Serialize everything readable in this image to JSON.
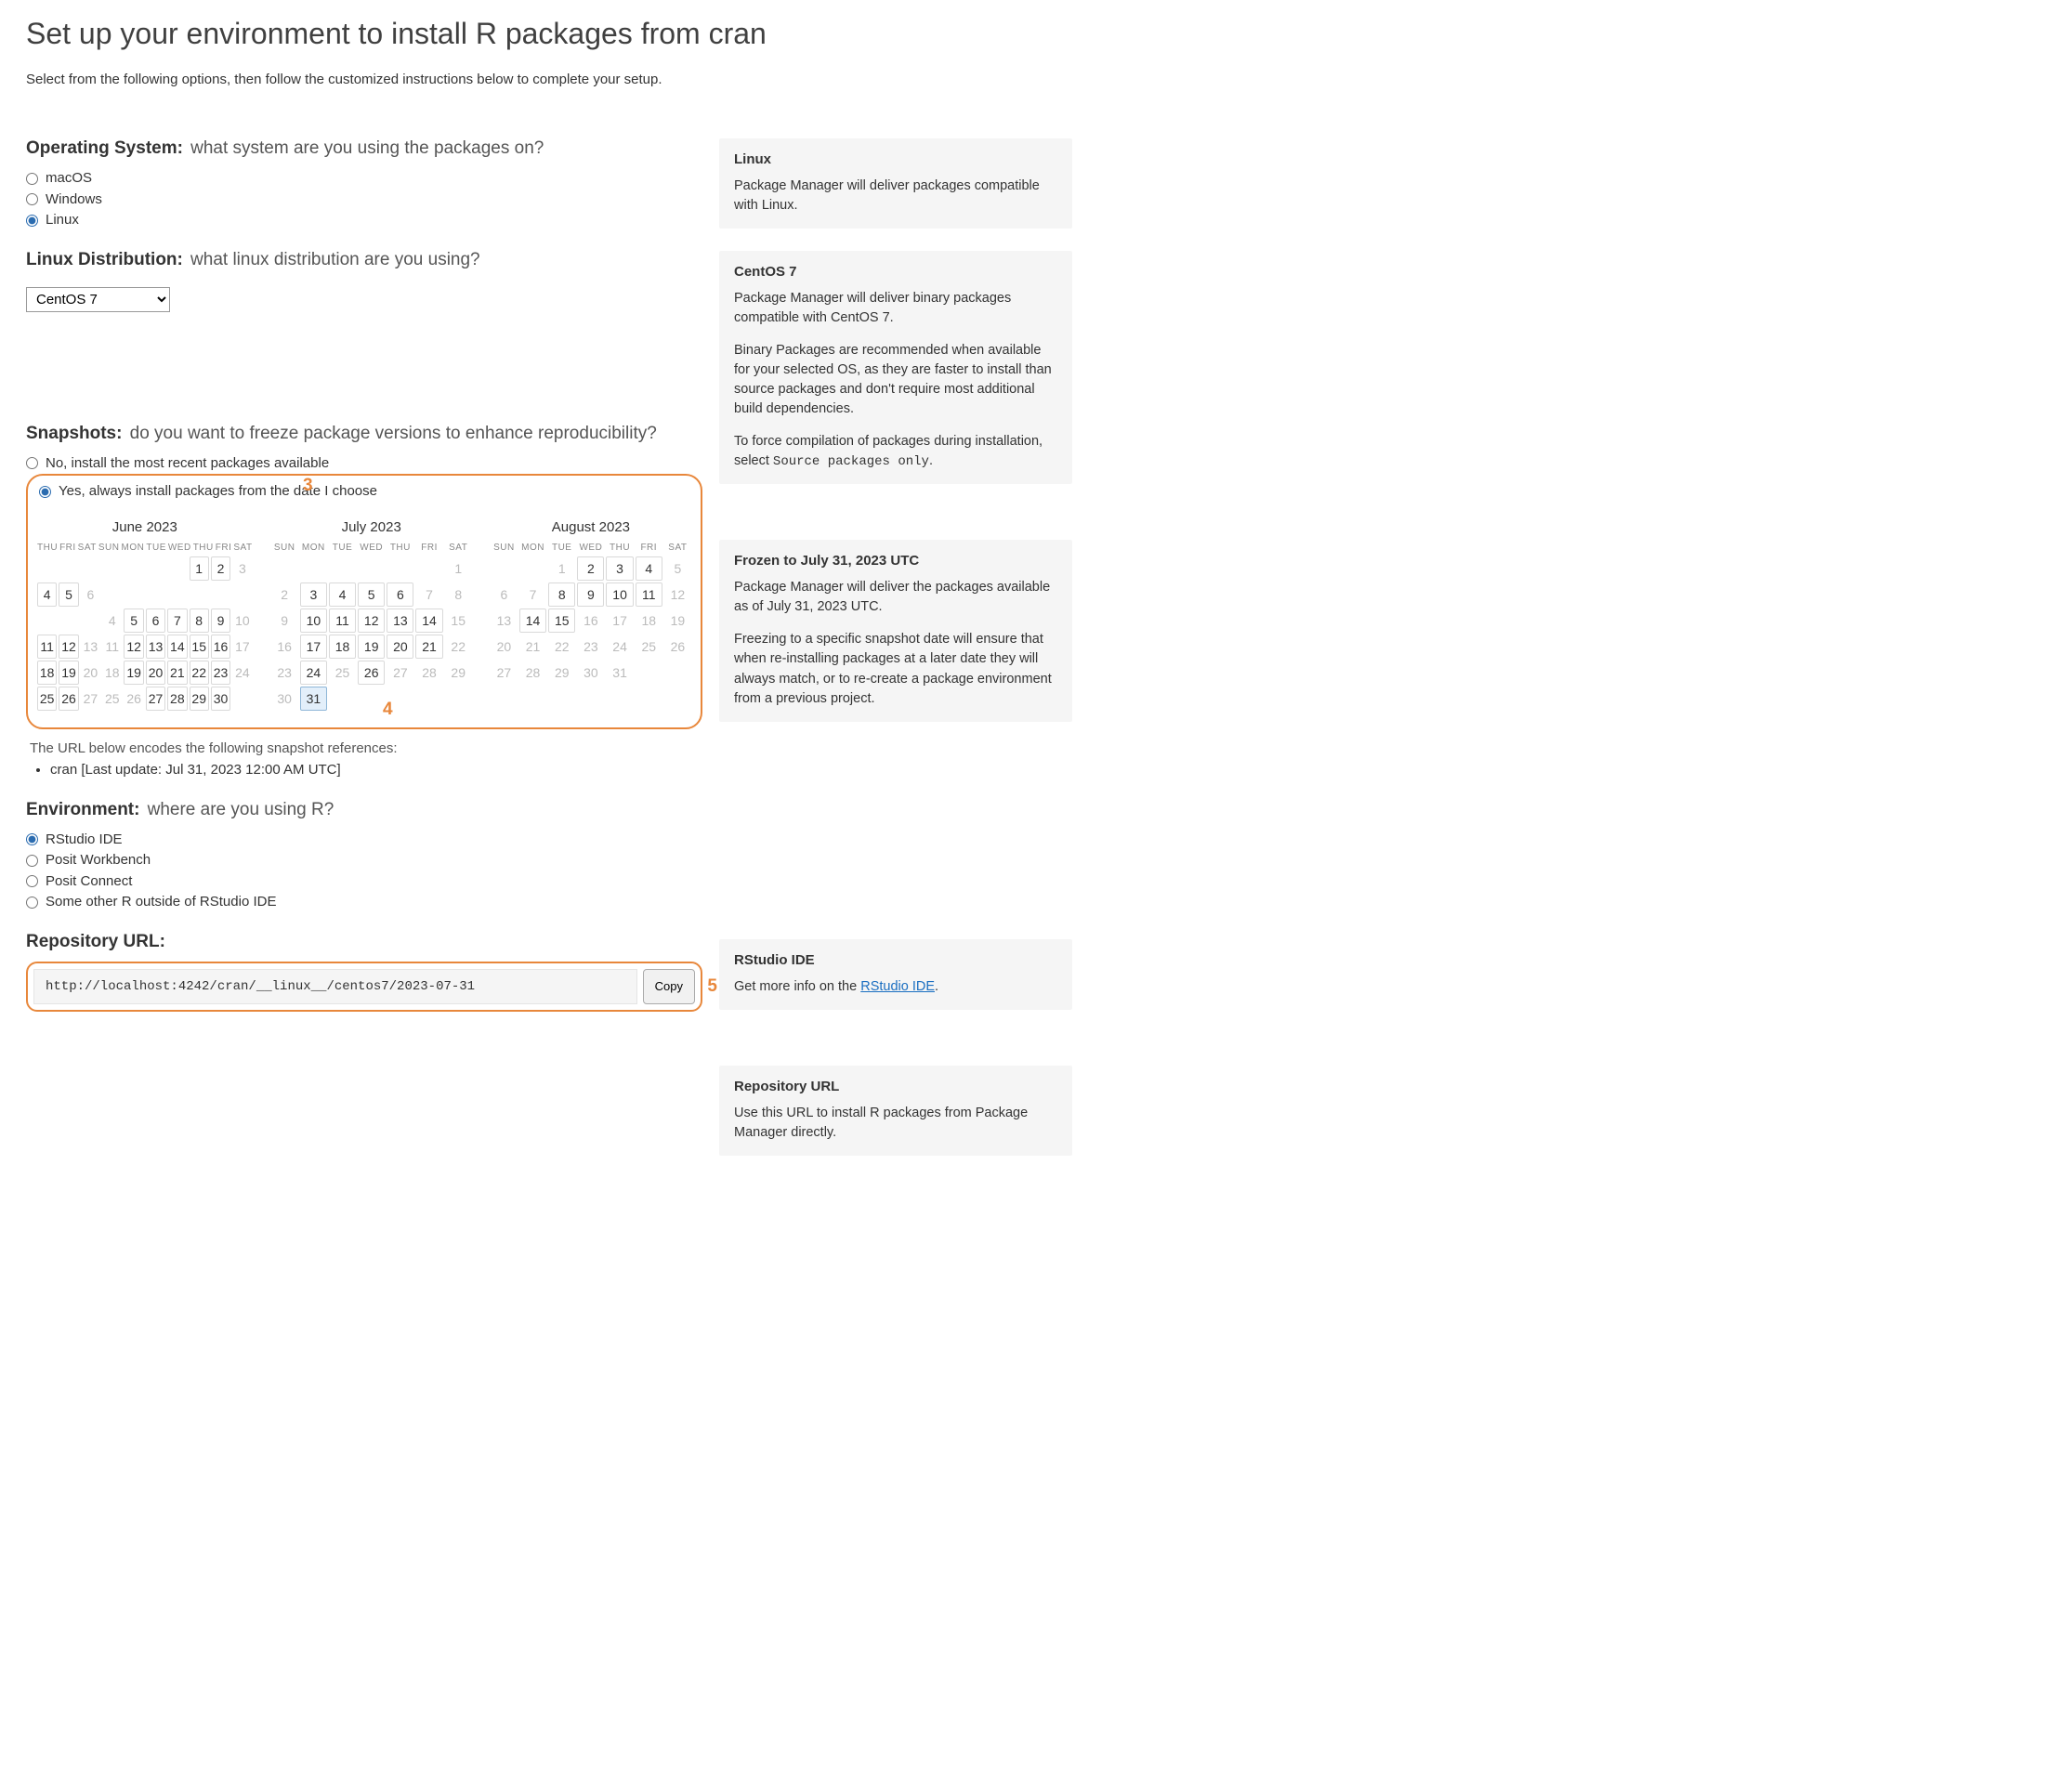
{
  "page": {
    "title": "Set up your environment to install R packages from cran",
    "intro": "Select from the following options, then follow the customized instructions below to complete your setup."
  },
  "os": {
    "title": "Operating System:",
    "subtitle": "what system are you using the packages on?",
    "options": [
      "macOS",
      "Windows",
      "Linux"
    ],
    "selected": "Linux"
  },
  "os_info": {
    "title": "Linux",
    "body": "Package Manager will deliver packages compatible with Linux."
  },
  "distro": {
    "title": "Linux Distribution:",
    "subtitle": "what linux distribution are you using?",
    "selected": "CentOS 7"
  },
  "distro_info": {
    "title": "CentOS 7",
    "p1": "Package Manager will deliver binary packages compatible with CentOS 7.",
    "p2": "Binary Packages are recommended when available for your selected OS, as they are faster to install than source packages and don't require most additional build dependencies.",
    "p3_pre": "To force compilation of packages during installation, select ",
    "p3_code": "Source packages only",
    "p3_post": "."
  },
  "snapshots": {
    "title": "Snapshots:",
    "subtitle": "do you want to freeze package versions to enhance reproducibility?",
    "opt_no": "No, install the most recent packages available",
    "opt_yes": "Yes, always install packages from the date I choose",
    "selected": "yes",
    "annot3": "3",
    "annot4": "4",
    "note": "The URL below encodes the following snapshot references:",
    "ref": "cran [Last update: Jul 31, 2023 12:00 AM UTC]"
  },
  "snapshot_info": {
    "title": "Frozen to July 31, 2023 UTC",
    "p1": "Package Manager will deliver the packages available as of July 31, 2023 UTC.",
    "p2": "Freezing to a specific snapshot date will ensure that when re-installing packages at a later date they will always match, or to re-create a package environment from a previous project."
  },
  "calendars": {
    "dow": [
      "SUN",
      "MON",
      "TUE",
      "WED",
      "THU",
      "FRI",
      "SAT"
    ],
    "dow_start_thu": [
      "THU",
      "FRI",
      "SAT",
      "SUN",
      "MON",
      "TUE",
      "WED",
      "THU",
      "FRI",
      "SAT"
    ],
    "months": [
      {
        "name": "June 2023",
        "trailing_header": true,
        "weeks": [
          [
            null,
            null,
            null,
            null,
            null,
            null,
            null,
            {
              "d": 1,
              "a": true
            },
            {
              "d": 2,
              "a": true
            },
            {
              "d": 3,
              "a": false
            }
          ],
          [
            {
              "d": 4,
              "a": true
            },
            {
              "d": 5,
              "a": true
            },
            {
              "d": 6,
              "a": false
            },
            null,
            null,
            null,
            null,
            null,
            null,
            null
          ],
          [
            null,
            null,
            null,
            {
              "d": 4,
              "a": false
            },
            {
              "d": 5,
              "a": true
            },
            {
              "d": 6,
              "a": true
            },
            {
              "d": 7,
              "a": true
            },
            {
              "d": 8,
              "a": true
            },
            {
              "d": 9,
              "a": true
            },
            {
              "d": 10,
              "a": false
            }
          ],
          [
            {
              "d": 11,
              "a": true
            },
            {
              "d": 12,
              "a": true
            },
            {
              "d": 13,
              "a": false
            },
            {
              "d": 11,
              "a": false
            },
            {
              "d": 12,
              "a": true
            },
            {
              "d": 13,
              "a": true
            },
            {
              "d": 14,
              "a": true
            },
            {
              "d": 15,
              "a": true
            },
            {
              "d": 16,
              "a": true
            },
            {
              "d": 17,
              "a": false
            }
          ],
          [
            {
              "d": 18,
              "a": true
            },
            {
              "d": 19,
              "a": true
            },
            {
              "d": 20,
              "a": false
            },
            {
              "d": 18,
              "a": false
            },
            {
              "d": 19,
              "a": true
            },
            {
              "d": 20,
              "a": true
            },
            {
              "d": 21,
              "a": true
            },
            {
              "d": 22,
              "a": true
            },
            {
              "d": 23,
              "a": true
            },
            {
              "d": 24,
              "a": false
            }
          ],
          [
            {
              "d": 25,
              "a": true
            },
            {
              "d": 26,
              "a": true
            },
            {
              "d": 27,
              "a": false
            },
            {
              "d": 25,
              "a": false
            },
            {
              "d": 26,
              "a": false
            },
            {
              "d": 27,
              "a": true
            },
            {
              "d": 28,
              "a": true
            },
            {
              "d": 29,
              "a": true
            },
            {
              "d": 30,
              "a": true
            },
            null
          ]
        ]
      },
      {
        "name": "July 2023",
        "weeks": [
          [
            null,
            null,
            null,
            null,
            null,
            null,
            {
              "d": 1,
              "a": false
            }
          ],
          [
            {
              "d": 2,
              "a": false
            },
            {
              "d": 3,
              "a": true
            },
            {
              "d": 4,
              "a": true
            },
            {
              "d": 5,
              "a": true
            },
            {
              "d": 6,
              "a": true
            },
            {
              "d": 7,
              "a": false
            },
            {
              "d": 8,
              "a": false
            }
          ],
          [
            {
              "d": 9,
              "a": false
            },
            {
              "d": 10,
              "a": true
            },
            {
              "d": 11,
              "a": true
            },
            {
              "d": 12,
              "a": true
            },
            {
              "d": 13,
              "a": true
            },
            {
              "d": 14,
              "a": true
            },
            {
              "d": 15,
              "a": false
            }
          ],
          [
            {
              "d": 16,
              "a": false
            },
            {
              "d": 17,
              "a": true
            },
            {
              "d": 18,
              "a": true
            },
            {
              "d": 19,
              "a": true
            },
            {
              "d": 20,
              "a": true
            },
            {
              "d": 21,
              "a": true
            },
            {
              "d": 22,
              "a": false
            }
          ],
          [
            {
              "d": 23,
              "a": false
            },
            {
              "d": 24,
              "a": true
            },
            {
              "d": 25,
              "a": false
            },
            {
              "d": 26,
              "a": true
            },
            {
              "d": 27,
              "a": false
            },
            {
              "d": 28,
              "a": false
            },
            {
              "d": 29,
              "a": false
            }
          ],
          [
            {
              "d": 30,
              "a": false
            },
            {
              "d": 31,
              "a": true,
              "sel": true
            },
            null,
            null,
            null,
            null,
            null
          ]
        ]
      },
      {
        "name": "August 2023",
        "weeks": [
          [
            null,
            null,
            {
              "d": 1,
              "a": false
            },
            {
              "d": 2,
              "a": true
            },
            {
              "d": 3,
              "a": true
            },
            {
              "d": 4,
              "a": true
            },
            {
              "d": 5,
              "a": false
            }
          ],
          [
            {
              "d": 6,
              "a": false
            },
            {
              "d": 7,
              "a": false
            },
            {
              "d": 8,
              "a": true
            },
            {
              "d": 9,
              "a": true
            },
            {
              "d": 10,
              "a": true
            },
            {
              "d": 11,
              "a": true
            },
            {
              "d": 12,
              "a": false
            }
          ],
          [
            {
              "d": 13,
              "a": false
            },
            {
              "d": 14,
              "a": true
            },
            {
              "d": 15,
              "a": true
            },
            {
              "d": 16,
              "a": false
            },
            {
              "d": 17,
              "a": false
            },
            {
              "d": 18,
              "a": false
            },
            {
              "d": 19,
              "a": false
            }
          ],
          [
            {
              "d": 20,
              "a": false
            },
            {
              "d": 21,
              "a": false
            },
            {
              "d": 22,
              "a": false
            },
            {
              "d": 23,
              "a": false
            },
            {
              "d": 24,
              "a": false
            },
            {
              "d": 25,
              "a": false
            },
            {
              "d": 26,
              "a": false
            }
          ],
          [
            {
              "d": 27,
              "a": false
            },
            {
              "d": 28,
              "a": false
            },
            {
              "d": 29,
              "a": false
            },
            {
              "d": 30,
              "a": false
            },
            {
              "d": 31,
              "a": false
            },
            null,
            null
          ]
        ]
      }
    ]
  },
  "env": {
    "title": "Environment:",
    "subtitle": "where are you using R?",
    "options": [
      "RStudio IDE",
      "Posit Workbench",
      "Posit Connect",
      "Some other R outside of RStudio IDE"
    ],
    "selected": "RStudio IDE"
  },
  "env_info": {
    "title": "RStudio IDE",
    "pre": "Get more info on the ",
    "link_text": "RStudio IDE",
    "post": "."
  },
  "repo": {
    "title": "Repository URL:",
    "url": "http://localhost:4242/cran/__linux__/centos7/2023-07-31",
    "copy": "Copy",
    "annot5": "5"
  },
  "repo_info": {
    "title": "Repository URL",
    "body": "Use this URL to install R packages from Package Manager directly."
  }
}
